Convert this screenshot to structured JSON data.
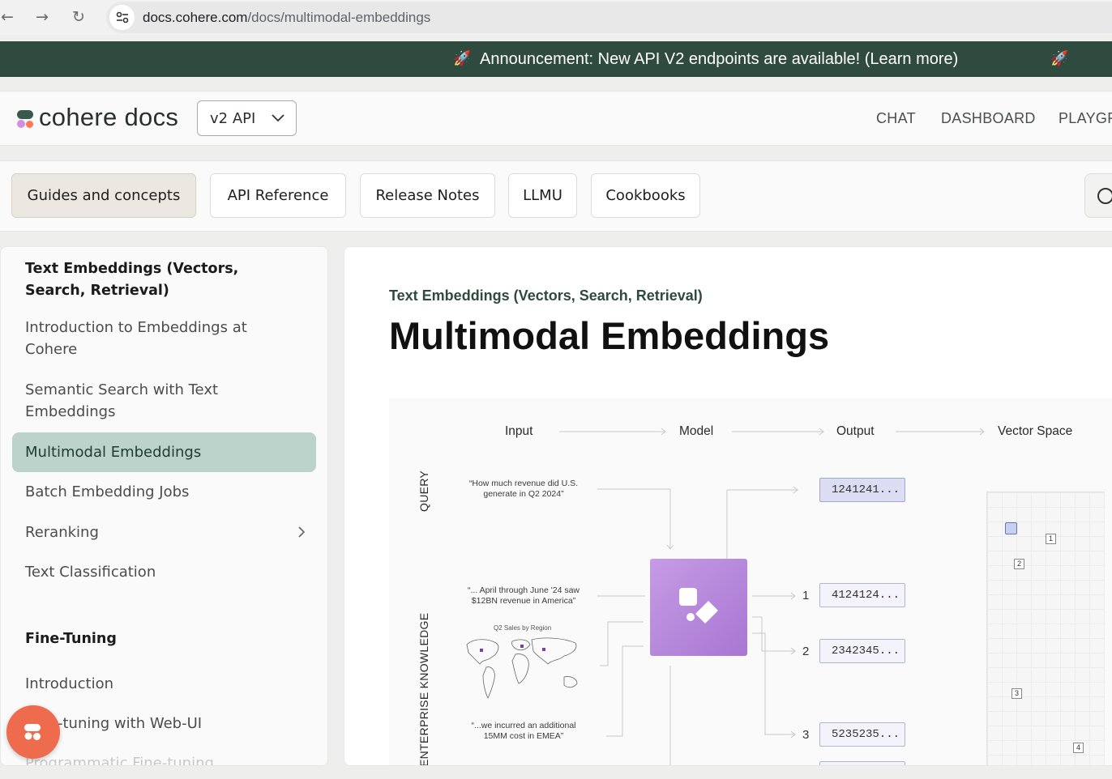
{
  "browser": {
    "url_host": "docs.cohere.com",
    "url_path": "/docs/multimodal-embeddings"
  },
  "announcement": {
    "text": "Announcement: New API V2 endpoints are available! (Learn more)"
  },
  "header": {
    "logo": "cohere docs",
    "version_selector": "v2 API",
    "nav": [
      "CHAT",
      "DASHBOARD",
      "PLAYGR"
    ]
  },
  "tabs": [
    {
      "label": "Guides and concepts",
      "active": true
    },
    {
      "label": "API Reference",
      "active": false
    },
    {
      "label": "Release Notes",
      "active": false
    },
    {
      "label": "LLMU",
      "active": false
    },
    {
      "label": "Cookbooks",
      "active": false
    }
  ],
  "sidebar": {
    "section1_title": "Text Embeddings (Vectors, Search, Retrieval)",
    "items": [
      "Introduction to Embeddings at Cohere",
      "Semantic Search with Text Embeddings",
      "Multimodal Embeddings",
      "Batch Embedding Jobs",
      "Reranking",
      "Text Classification"
    ],
    "active_item": "Multimodal Embeddings",
    "section2_title": "Fine-Tuning",
    "items2": [
      "Introduction",
      "-tuning with Web-UI",
      "Programmatic Fine-tuning"
    ]
  },
  "content": {
    "breadcrumb": "Text Embeddings (Vectors, Search, Retrieval)",
    "title": "Multimodal Embeddings",
    "diagram": {
      "columns": [
        "Input",
        "Model",
        "Output",
        "Vector Space"
      ],
      "query_label": "QUERY",
      "knowledge_label": "ENTERPRISE KNOWLEDGE",
      "query_text": "“How much revenue did U.S. generate in Q2 2024”",
      "doc1_text": "“... April through June '24 saw $12BN revenue in America”",
      "map_title": "Q2 Sales by Region",
      "doc3_text": "“...we incurred an additional 15MM cost in EMEA”",
      "query_vector": "1241241...",
      "vectors": [
        {
          "num": "1",
          "value": "4124124..."
        },
        {
          "num": "2",
          "value": "2342345..."
        },
        {
          "num": "3",
          "value": "5235235..."
        }
      ],
      "space_tags": [
        "1",
        "2",
        "3",
        "4"
      ]
    }
  }
}
